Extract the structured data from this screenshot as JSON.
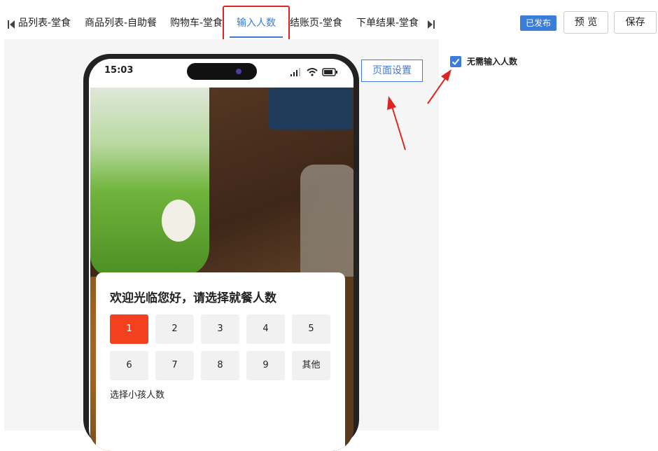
{
  "tabs": [
    {
      "label": "品列表-堂食"
    },
    {
      "label": "商品列表-自助餐"
    },
    {
      "label": "购物车-堂食"
    },
    {
      "label": "输入人数"
    },
    {
      "label": "结账页-堂食"
    },
    {
      "label": "下单结果-堂食"
    }
  ],
  "header": {
    "status_badge": "已发布",
    "preview_label": "预 览",
    "save_label": "保存"
  },
  "phone": {
    "time": "15:03",
    "welcome_title": "欢迎光临您好，请选择就餐人数",
    "count_options": [
      "1",
      "2",
      "3",
      "4",
      "5",
      "6",
      "7",
      "8",
      "9",
      "其他"
    ],
    "selected_count": "1",
    "kids_label": "选择小孩人数"
  },
  "page_settings_label": "页面设置",
  "options": {
    "no_count_label": "无需输入人数",
    "no_count_checked": true
  },
  "colors": {
    "accent": "#3d7bd4",
    "selected": "#f3401f",
    "annotation": "#e02424"
  }
}
